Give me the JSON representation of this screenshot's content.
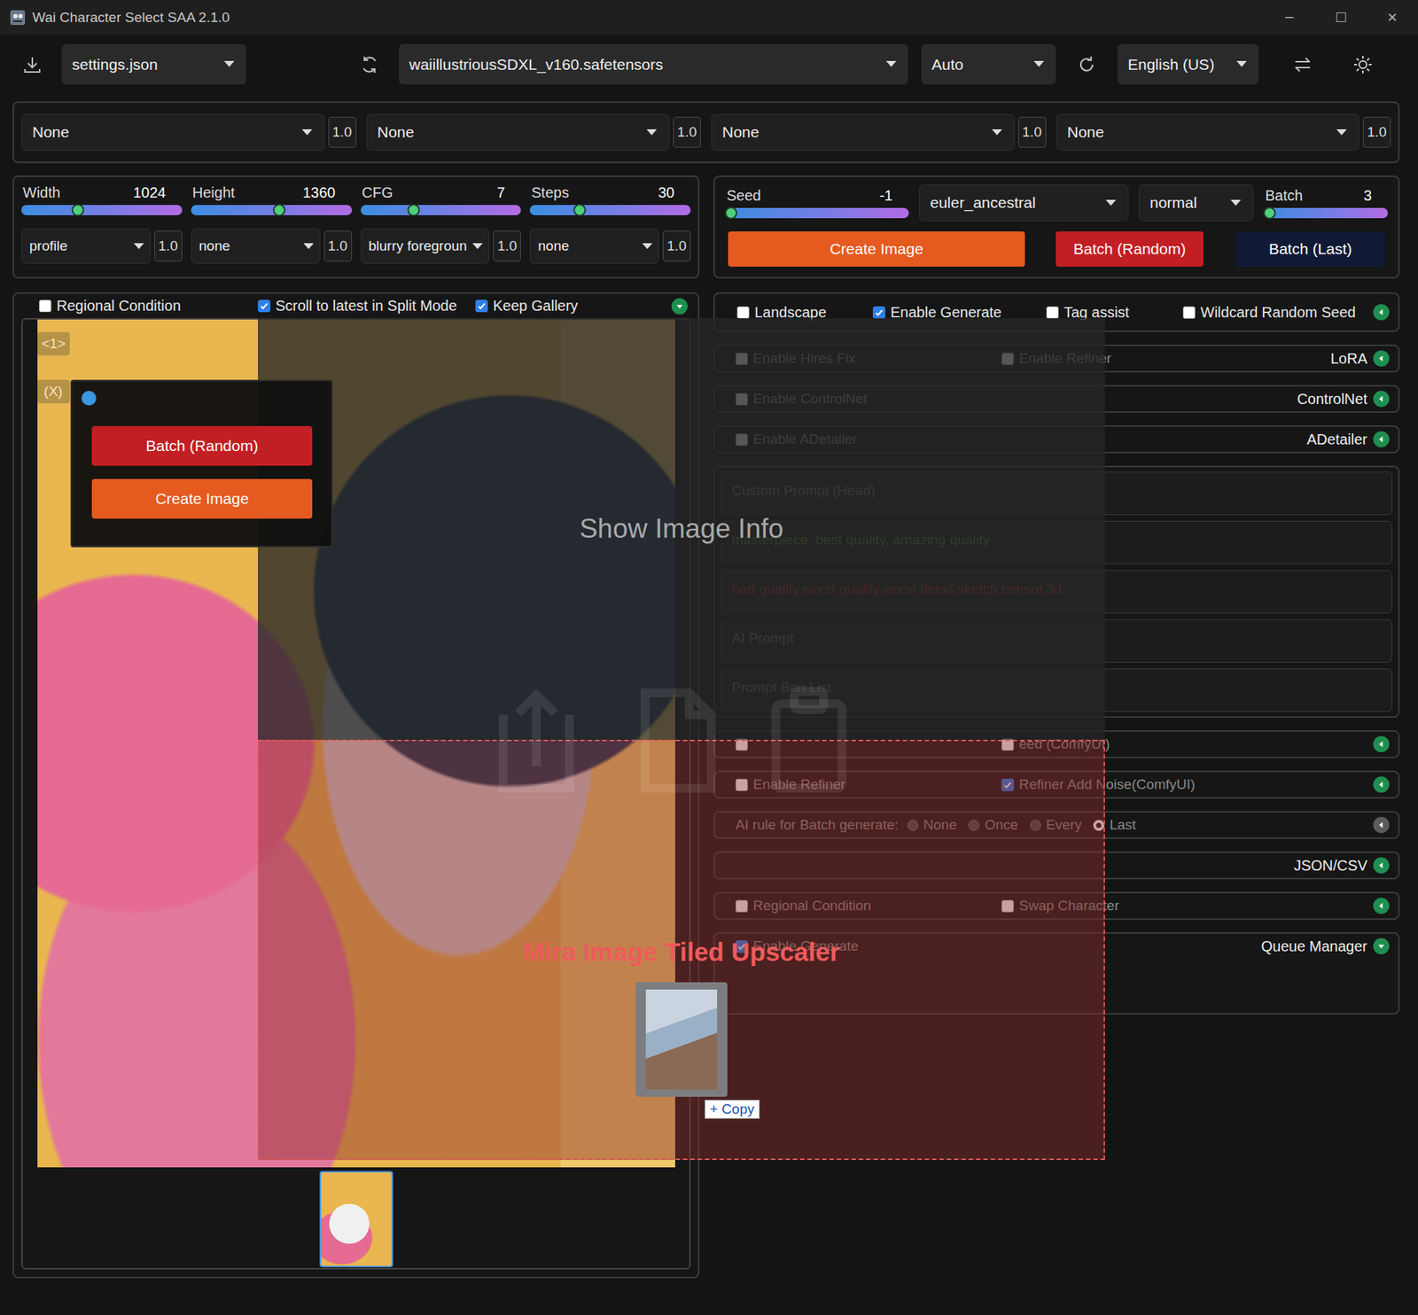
{
  "window": {
    "title": "Wai Character Select SAA 2.1.0",
    "controls": [
      "─",
      "☐",
      "✕"
    ]
  },
  "toolbar": {
    "settings": "settings.json",
    "model": "waiillustriousSDXL_v160.safetensors",
    "mode": "Auto",
    "language": "English (US)"
  },
  "loras": [
    {
      "name": "None",
      "weight": "1.0"
    },
    {
      "name": "None",
      "weight": "1.0"
    },
    {
      "name": "None",
      "weight": "1.0"
    },
    {
      "name": "None",
      "weight": "1.0"
    }
  ],
  "sliders": [
    {
      "label": "Width",
      "value": "1024",
      "level": 0.35
    },
    {
      "label": "Height",
      "value": "1360",
      "level": 0.55
    },
    {
      "label": "CFG",
      "value": "7",
      "level": 0.33
    },
    {
      "label": "Steps",
      "value": "30",
      "level": 0.31
    }
  ],
  "presets": [
    {
      "value": "profile",
      "weight": "1.0"
    },
    {
      "value": "none",
      "weight": "1.0"
    },
    {
      "value": "blurry foregroun",
      "weight": "1.0"
    },
    {
      "value": "none",
      "weight": "1.0"
    }
  ],
  "seed": {
    "label": "Seed",
    "value": "-1",
    "level": 0.03
  },
  "sampler": "euler_ancestral",
  "scheduler": "normal",
  "batch": {
    "label": "Batch",
    "value": "3",
    "level": 0.05
  },
  "actions": [
    {
      "label": "Create Image",
      "color": "#e55a1f"
    },
    {
      "label": "Batch (Random)",
      "color": "#c21f24"
    },
    {
      "label": "Batch (Last)",
      "color": "#111a35"
    }
  ],
  "left_options": {
    "items": [
      {
        "label": "Regional Condition",
        "checked": false
      },
      {
        "label": "Scroll to latest in Split Mode",
        "checked": true
      },
      {
        "label": "Keep Gallery",
        "checked": true
      }
    ],
    "expanded": true
  },
  "gallery": {
    "badges": [
      "<1>",
      "(X)"
    ],
    "thumbnails": [
      {
        "selected": true
      }
    ]
  },
  "right_options": {
    "items": [
      {
        "label": "Landscape",
        "checked": false
      },
      {
        "label": "Enable Generate",
        "checked": true
      },
      {
        "label": "Tag assist",
        "checked": false
      },
      {
        "label": "Wildcard Random Seed",
        "checked": false
      }
    ],
    "expanded": false
  },
  "sections": [
    {
      "kind": "accordion",
      "label": "LoRA",
      "expanded": false,
      "active": true,
      "options": [
        {
          "label": "Enable Hires Fix",
          "checked": false
        },
        {
          "label": "Enable Refiner",
          "checked": false
        }
      ]
    },
    {
      "kind": "accordion",
      "label": "ControlNet",
      "expanded": false,
      "active": true,
      "options": [
        {
          "label": "Enable ControlNet",
          "checked": false
        }
      ]
    },
    {
      "kind": "accordion",
      "label": "ADetailer",
      "expanded": false,
      "active": true,
      "options": [
        {
          "label": "Enable ADetailer",
          "checked": false
        }
      ]
    },
    {
      "kind": "prompts",
      "fields": [
        {
          "placeholder": "Custom Prompt (Head)"
        },
        {
          "value": "masterpiece, best quality, amazing quality",
          "color": "#4c8b3c"
        },
        {
          "value": "bad quality,worst quality,worst detail,sketch,censor,3d",
          "color": "#a83232"
        },
        {
          "placeholder": "AI Prompt"
        },
        {
          "placeholder": "Prompt Ban List"
        }
      ]
    },
    {
      "kind": "options",
      "expanded": false,
      "active": true,
      "options": [
        {
          "checked": false
        },
        {
          "label": "eed (ComfyUI)",
          "checked": false
        }
      ]
    },
    {
      "kind": "options",
      "expanded": false,
      "active": true,
      "options": [
        {
          "label": "Enable Refiner",
          "checked": false
        },
        {
          "label": "Refiner Add Noise(ComfyUI)",
          "checked": true
        }
      ]
    },
    {
      "kind": "radio",
      "label": "AI rule for Batch generate:",
      "expanded": false,
      "active": false,
      "choices": [
        {
          "label": "None",
          "selected": false
        },
        {
          "label": "Once",
          "selected": false
        },
        {
          "label": "Every",
          "selected": false
        },
        {
          "label": "Last",
          "selected": true
        }
      ]
    },
    {
      "kind": "accordion",
      "label": "JSON/CSV",
      "expanded": false,
      "active": true,
      "options": []
    },
    {
      "kind": "options",
      "expanded": false,
      "active": true,
      "options": [
        {
          "label": "Regional Condition",
          "checked": false
        },
        {
          "label": "Swap Character",
          "checked": false
        }
      ]
    },
    {
      "kind": "panel",
      "label": "Queue Manager",
      "expanded": true,
      "active": true,
      "options": [
        {
          "label": "Enable Generate",
          "checked": true
        }
      ]
    }
  ],
  "overlay": {
    "info": "Show Image Info",
    "dropzone": {
      "title": "Mira Image Tiled Upscaler",
      "badge": "+ Copy"
    }
  },
  "popup": {
    "buttons": [
      {
        "label": "Batch (Random)",
        "color": "#c21f24"
      },
      {
        "label": "Create Image",
        "color": "#e55a1f"
      }
    ]
  }
}
